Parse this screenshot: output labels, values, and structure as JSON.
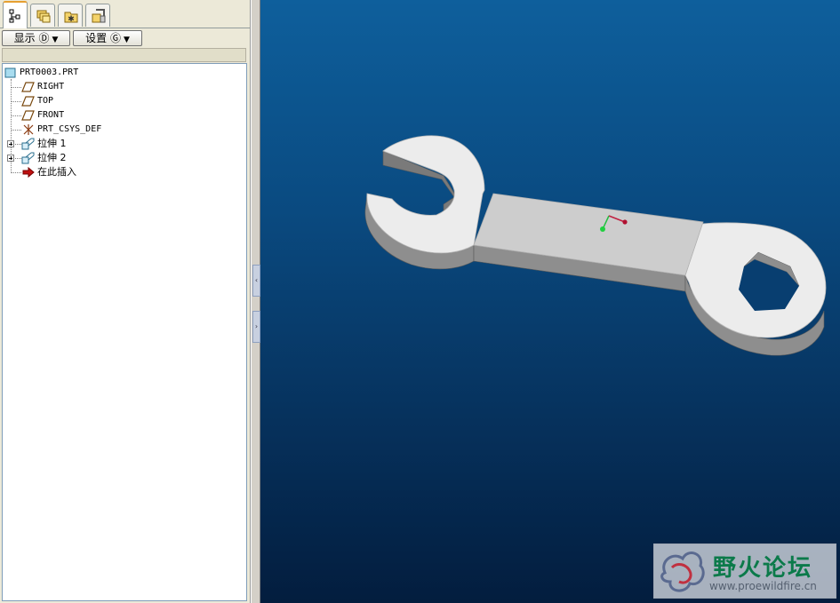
{
  "tabs": [
    {
      "icon": "model-tree-icon",
      "active": true
    },
    {
      "icon": "folder-browser-icon",
      "active": false
    },
    {
      "icon": "favorites-icon",
      "active": false
    },
    {
      "icon": "connections-icon",
      "active": false
    }
  ],
  "toolbar": {
    "show_label": "显示 Ⓓ",
    "settings_label": "设置 Ⓖ"
  },
  "model_tree": {
    "root": "PRT0003.PRT",
    "items": [
      {
        "label": "RIGHT",
        "icon": "datum-plane-icon"
      },
      {
        "label": "TOP",
        "icon": "datum-plane-icon"
      },
      {
        "label": "FRONT",
        "icon": "datum-plane-icon"
      },
      {
        "label": "PRT_CSYS_DEF",
        "icon": "csys-icon"
      },
      {
        "label": "拉伸 1",
        "icon": "extrude-icon"
      },
      {
        "label": "拉伸 2",
        "icon": "extrude-icon"
      },
      {
        "label": "在此插入",
        "icon": "insert-here-arrow-icon"
      }
    ]
  },
  "watermark": {
    "title": "野火论坛",
    "url": "www.proewildfire.cn"
  },
  "colors": {
    "viewport_top": "#0e5f9c",
    "viewport_bottom": "#031d3e",
    "part_face": "#e8e8e8",
    "part_side": "#8e8e8e",
    "watermark_green": "#0b7a4a"
  }
}
